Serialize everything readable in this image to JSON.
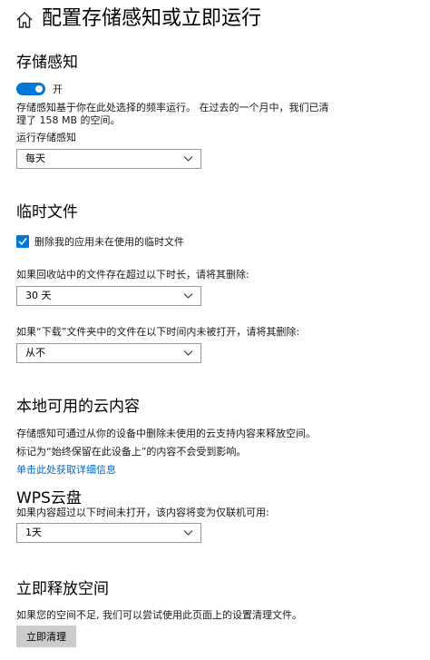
{
  "page": {
    "title": "配置存储感知或立即运行",
    "home_icon": "home-icon"
  },
  "storage_sense": {
    "heading": "存储感知",
    "toggle_state": "on",
    "toggle_label": "开",
    "description_line1": "存储感知基于你在此处选择的频率运行。 在过去的一个月中，我们已清",
    "description_line2": "理了 158 MB 的空间。",
    "run_label": "运行存储感知",
    "run_value": "每天"
  },
  "temp_files": {
    "heading": "临时文件",
    "checkbox_checked": true,
    "checkbox_label": "删除我的应用未在使用的临时文件",
    "recycle_label": "如果回收站中的文件存在超过以下时长，请将其删除:",
    "recycle_value": "30 天",
    "downloads_label": "如果“下载”文件夹中的文件在以下时间内未被打开，请将其删除:",
    "downloads_value": "从不"
  },
  "cloud_content": {
    "heading": "本地可用的云内容",
    "line1": "存储感知可通过从你的设备中删除未使用的云支持内容来释放空间。",
    "line2": "标记为“始终保留在此设备上”的内容不会受到影响。",
    "link": "单击此处获取详细信息"
  },
  "wps": {
    "heading": "WPS云盘",
    "label": "如果内容超过以下时间未打开，该内容将变为仅联机可用:",
    "value": "1天"
  },
  "free_space": {
    "heading": "立即释放空间",
    "description": "如果您的空间不足, 我们可以尝试使用此页面上的设置清理文件。",
    "button": "立即清理"
  },
  "colors": {
    "accent": "#0078d7",
    "link": "#0067c0",
    "button_bg": "#cccccc"
  }
}
